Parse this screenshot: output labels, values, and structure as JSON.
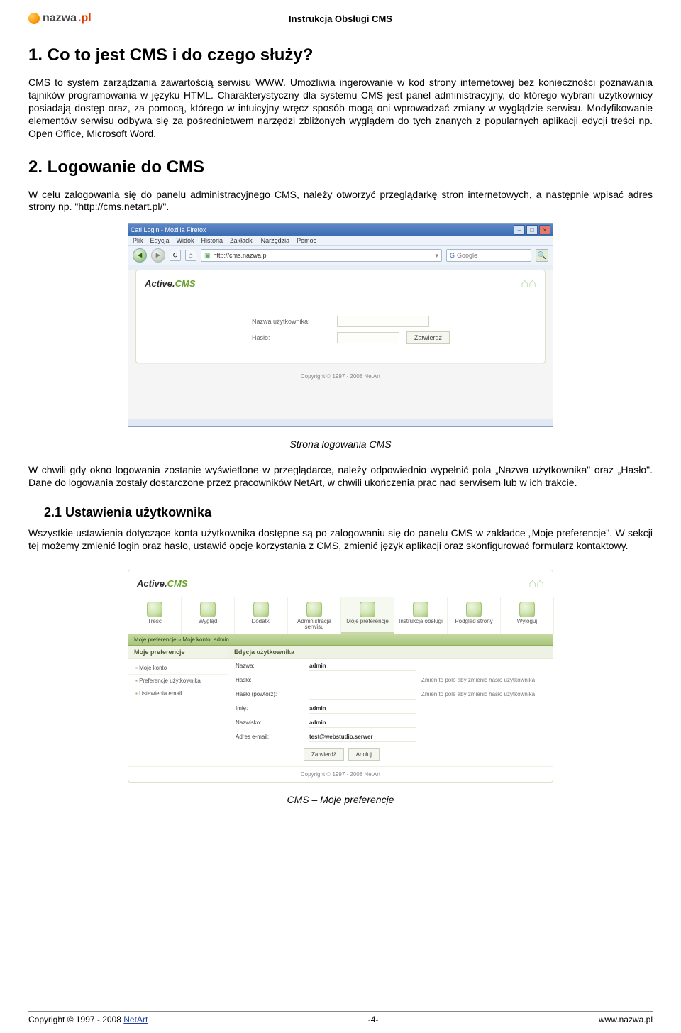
{
  "header": {
    "logo_nazwa": "nazwa",
    "logo_pl": ".pl",
    "title": "Instrukcja Obsługi CMS"
  },
  "section1": {
    "heading": "1. Co to jest CMS i do czego służy?",
    "body": "CMS to system zarządzania zawartością serwisu WWW. Umożliwia ingerowanie w kod strony internetowej bez konieczności poznawania tajników programowania w języku HTML. Charakterystyczny dla systemu CMS jest panel administracyjny, do którego wybrani użytkownicy posiadają dostęp oraz, za pomocą, którego w intuicyjny wręcz sposób mogą oni wprowadzać zmiany w wyglądzie serwisu. Modyfikowanie elementów serwisu odbywa się za pośrednictwem narzędzi zbliżonych wyglądem do tych znanych z popularnych aplikacji edycji treści np. Open Office, Microsoft Word."
  },
  "section2": {
    "heading": "2. Logowanie do CMS",
    "body1": "W celu zalogowania się do panelu administracyjnego CMS, należy otworzyć przeglądarkę stron internetowych, a następnie wpisać adres strony np. \"http://cms.netart.pl/\".",
    "caption1": "Strona logowania CMS",
    "body2": "W chwili gdy okno logowania zostanie wyświetlone w przeglądarce, należy odpowiednio wypełnić pola „Nazwa użytkownika\" oraz „Hasło\". Dane do logowania zostały dostarczone przez pracowników NetArt, w chwili ukończenia prac nad serwisem lub w ich trakcie.",
    "sub_heading": "2.1 Ustawienia użytkownika",
    "body3": "Wszystkie ustawienia dotyczące konta użytkownika dostępne są po zalogowaniu się do panelu CMS w zakładce „Moje preferencje\". W sekcji tej możemy zmienić login oraz hasło, ustawić opcje korzystania z CMS, zmienić język aplikacji oraz skonfigurować formularz kontaktowy.",
    "caption2": "CMS – Moje preferencje"
  },
  "screenshot1": {
    "title": "Cati Login - Mozilla Firefox",
    "menu": [
      "Plik",
      "Edycja",
      "Widok",
      "Historia",
      "Zakładki",
      "Narzędzia",
      "Pomoc"
    ],
    "url": "http://cms.nazwa.pl",
    "search_placeholder": "Google",
    "brand_active": "Active.",
    "brand_cms": "CMS",
    "label_user": "Nazwa użytkownika:",
    "label_pass": "Hasło:",
    "btn_submit": "Zatwierdź",
    "copyright": "Copyright © 1997 - 2008 NetArt"
  },
  "screenshot2": {
    "brand_active": "Active.",
    "brand_cms": "CMS",
    "nav": [
      "Treść",
      "Wygląd",
      "Dodatki",
      "Administracja serwisu",
      "Moje preferencje",
      "Instrukcja obsługi",
      "Podgląd strony",
      "Wyloguj"
    ],
    "nav_active_index": 4,
    "crumbs": "Moje preferencje » Moje konto: admin",
    "side_header": "Moje preferencje",
    "side_items": [
      "Moje konto",
      "Preferencje użytkownika",
      "Ustawienia email"
    ],
    "form_header": "Edycja użytkownika",
    "rows": [
      {
        "label": "Nazwa:",
        "value": "admin",
        "hint": ""
      },
      {
        "label": "Hasło:",
        "value": "",
        "hint": "Zmień to pole aby zmienić hasło użytkownika"
      },
      {
        "label": "Hasło (powtórz):",
        "value": "",
        "hint": "Zmień to pole aby zmienić hasło użytkownika"
      },
      {
        "label": "Imię:",
        "value": "admin",
        "hint": ""
      },
      {
        "label": "Nazwisko:",
        "value": "admin",
        "hint": ""
      },
      {
        "label": "Adres e-mail:",
        "value": "test@webstudio.serwer",
        "hint": ""
      }
    ],
    "btn_submit": "Zatwierdź",
    "btn_cancel": "Anuluj",
    "copyright": "Copyright © 1997 - 2008 NetArt"
  },
  "footer": {
    "left_prefix": "Copyright © 1997 - 2008 ",
    "left_link": "NetArt",
    "center": "-4-",
    "right": "www.nazwa.pl"
  }
}
